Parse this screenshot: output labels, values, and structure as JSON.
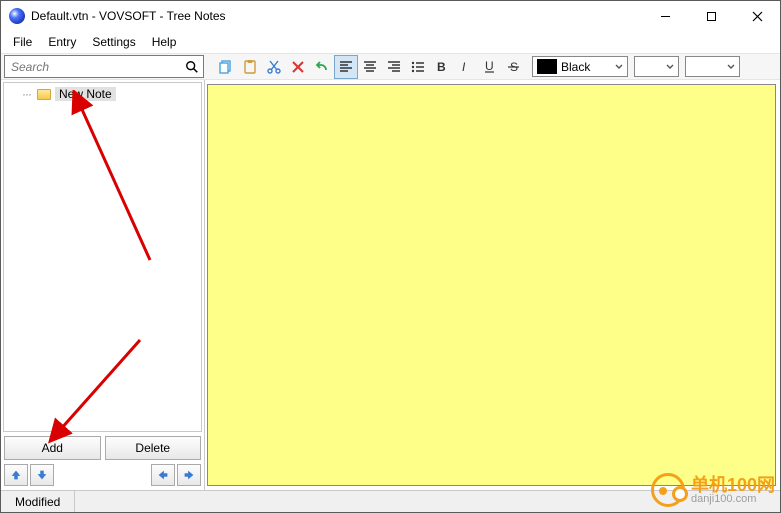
{
  "title": "Default.vtn - VOVSOFT - Tree Notes",
  "menu": {
    "file": "File",
    "entry": "Entry",
    "settings": "Settings",
    "help": "Help"
  },
  "search": {
    "placeholder": "Search"
  },
  "toolbar": {
    "color_label": "Black",
    "color_value": "#000000"
  },
  "tree": {
    "items": [
      {
        "label": "New Note"
      }
    ]
  },
  "buttons": {
    "add": "Add",
    "delete": "Delete"
  },
  "status": {
    "modified": "Modified"
  },
  "watermark": {
    "cn": "单机100网",
    "en": "danji100.com"
  }
}
